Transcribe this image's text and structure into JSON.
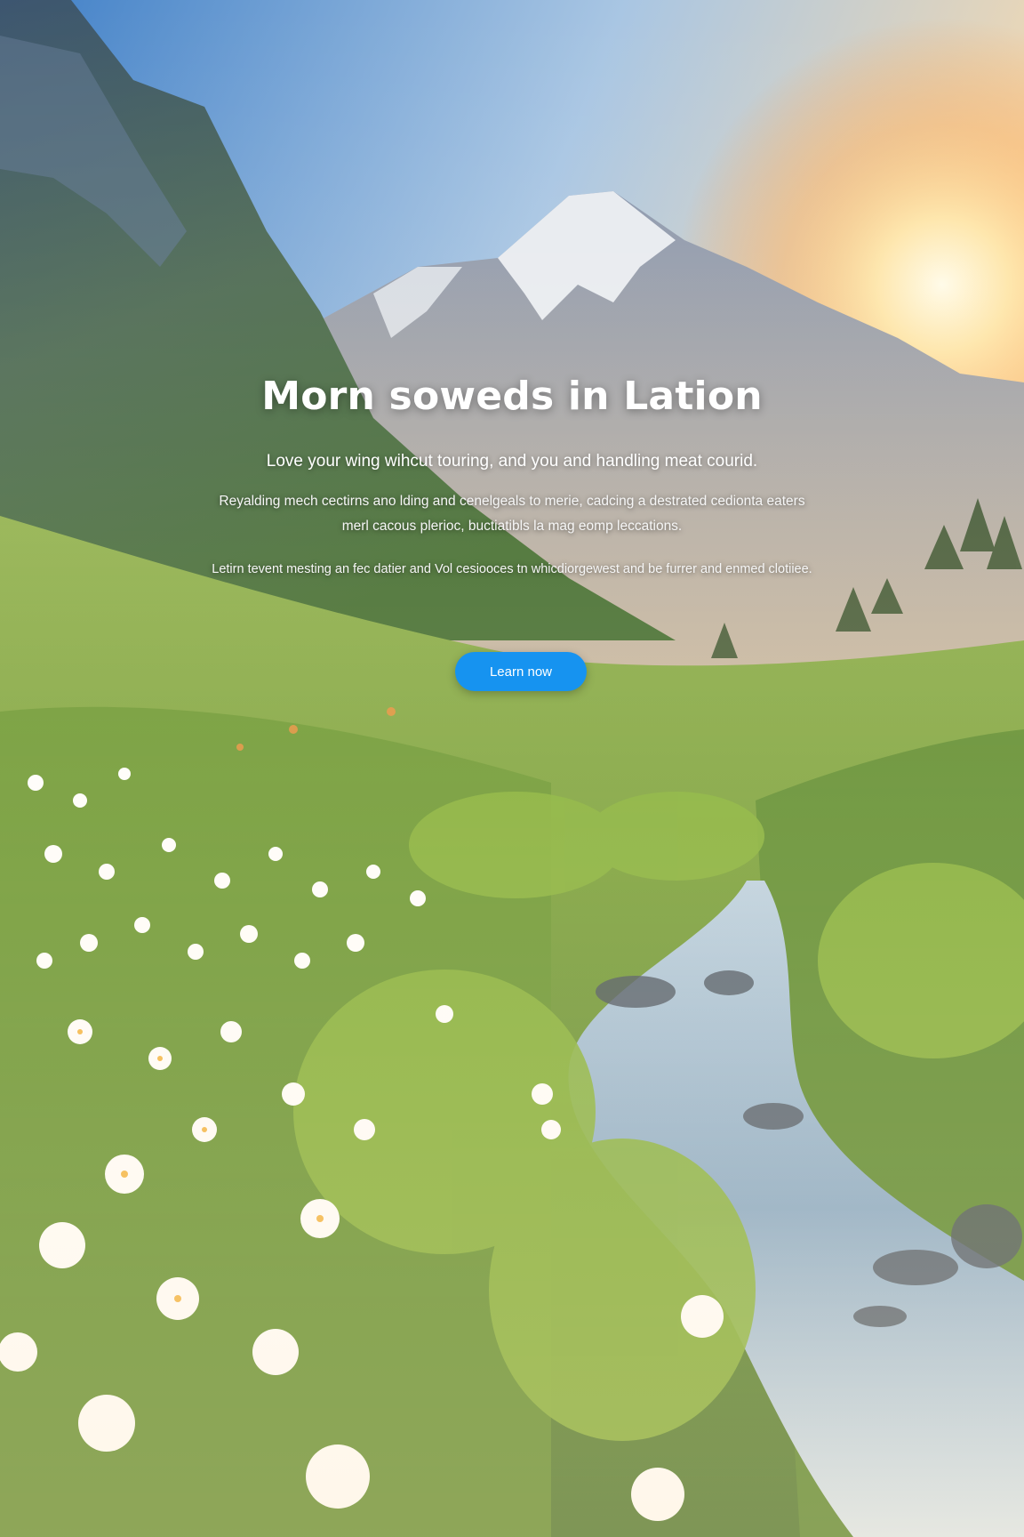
{
  "hero": {
    "title": "Morn soweds in Lation",
    "tagline": "Love your wing wihcut touring, and you and handling meat courid.",
    "paragraph1": "Reyalding mech cectirns ano lding and cenelgeals to merie, cadcing a destrated cedionta eaters merl cacous plerioc, buctiatibls la mag eomp leccations.",
    "paragraph2": "Letirn tevent mesting an fec datier and Vol cesiooces tn whicdiorgewest and be furrer and enmed clotiiee.",
    "cta_label": "Learn now"
  },
  "background": {
    "scene": "alpine meadow with snowy peaks, sunrise, white wildflowers and a mountain stream",
    "accent_color": "#1693f0"
  }
}
